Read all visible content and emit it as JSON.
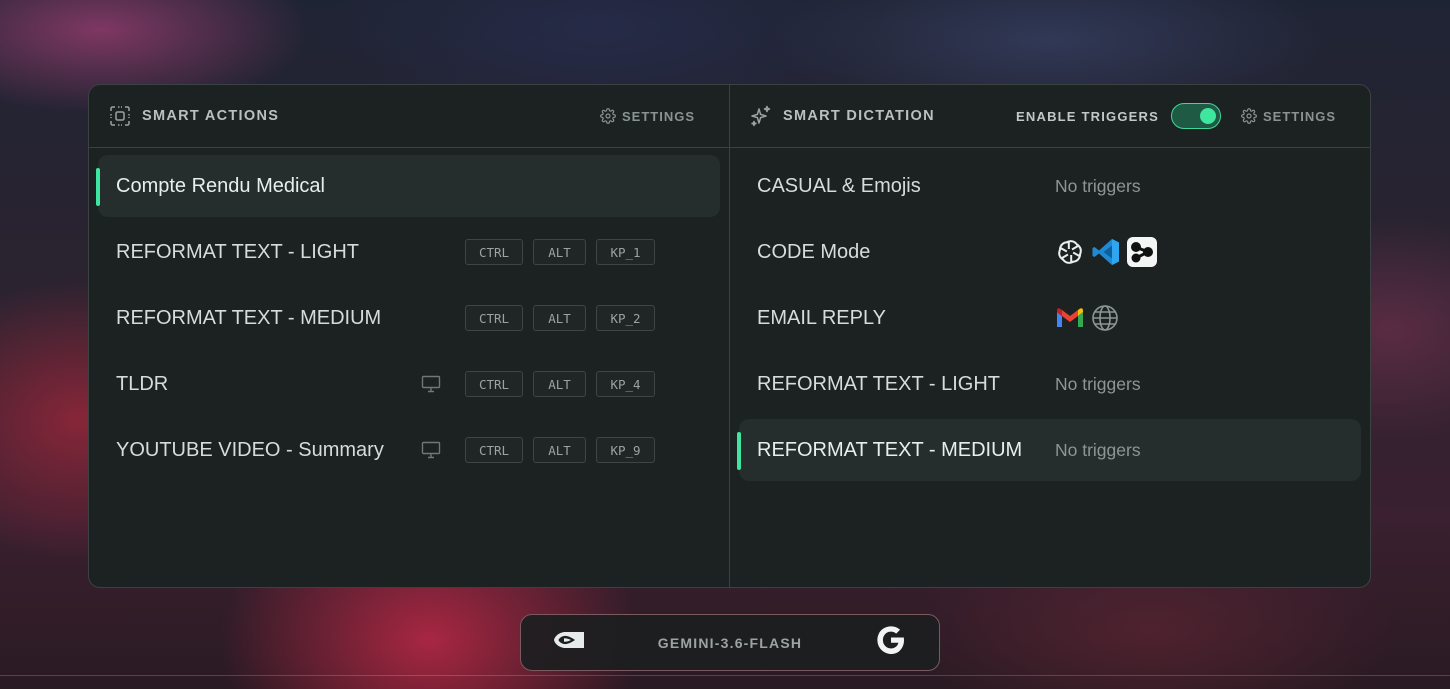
{
  "smart_actions": {
    "title": "SMART ACTIONS",
    "settings_label": "SETTINGS",
    "items": [
      {
        "label": "Compte Rendu Medical",
        "active": true,
        "keys": []
      },
      {
        "label": "REFORMAT TEXT - LIGHT",
        "monitor": false,
        "keys": [
          "CTRL",
          "ALT",
          "KP_1"
        ]
      },
      {
        "label": "REFORMAT TEXT - MEDIUM",
        "monitor": false,
        "keys": [
          "CTRL",
          "ALT",
          "KP_2"
        ]
      },
      {
        "label": "TLDR",
        "monitor": true,
        "keys": [
          "CTRL",
          "ALT",
          "KP_4"
        ]
      },
      {
        "label": "YOUTUBE VIDEO - Summary",
        "monitor": true,
        "keys": [
          "CTRL",
          "ALT",
          "KP_9"
        ]
      }
    ]
  },
  "smart_dictation": {
    "title": "SMART DICTATION",
    "enable_triggers_label": "ENABLE TRIGGERS",
    "enable_triggers_on": true,
    "settings_label": "SETTINGS",
    "items": [
      {
        "label": "CASUAL & Emojis",
        "triggers_text": "No triggers",
        "icons": []
      },
      {
        "label": "CODE Mode",
        "triggers_text": "",
        "icons": [
          "chatgpt-icon",
          "vscode-icon",
          "app-logo-icon"
        ]
      },
      {
        "label": "EMAIL REPLY",
        "triggers_text": "",
        "icons": [
          "gmail-icon",
          "globe-icon"
        ]
      },
      {
        "label": "REFORMAT TEXT - LIGHT",
        "triggers_text": "No triggers",
        "icons": []
      },
      {
        "label": "REFORMAT TEXT - MEDIUM",
        "triggers_text": "No triggers",
        "icons": [],
        "active": true
      }
    ]
  },
  "model_bar": {
    "model_name": "GEMINI-3.6-FLASH",
    "left_icon": "nvidia-icon",
    "right_icon": "google-icon"
  },
  "colors": {
    "accent": "#3ee6a0",
    "panel_bg": "#1c2222",
    "border": "#3a4242"
  }
}
